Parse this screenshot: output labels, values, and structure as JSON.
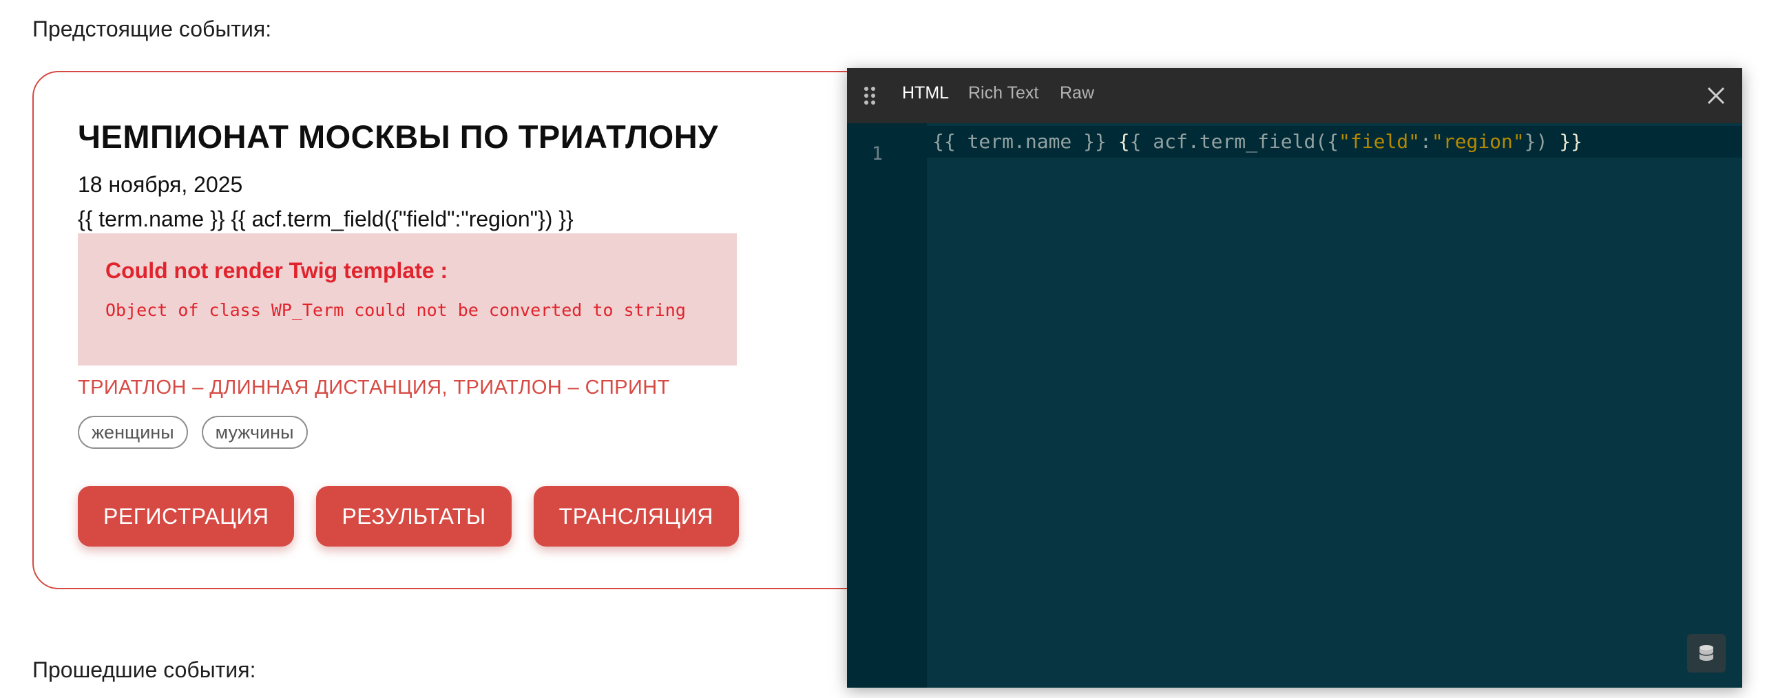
{
  "sections": {
    "upcoming_label": "Предстоящие события:",
    "past_label": "Прошедшие события:"
  },
  "event": {
    "title": "ЧЕМПИОНАТ МОСКВЫ ПО ТРИАТЛОНУ",
    "date": "18 ноября, 2025",
    "template_text": "{{ term.name }} {{ acf.term_field({\"field\":\"region\"}) }}",
    "error": {
      "title": "Could not render Twig template :",
      "message": "Object of class WP_Term could not be converted to string"
    },
    "disciplines": "ТРИАТЛОН – ДЛИННАЯ ДИСТАНЦИЯ, ТРИАТЛОН – СПРИНТ",
    "tags": [
      "женщины",
      "мужчины"
    ],
    "buttons": {
      "register": "РЕГИСТРАЦИЯ",
      "results": "РЕЗУЛЬТАТЫ",
      "broadcast": "ТРАНСЛЯЦИЯ"
    },
    "colors": {
      "accent": "#d64a43",
      "error_text": "#e0232c",
      "error_bg": "#f0d2d3"
    }
  },
  "editor": {
    "tabs": [
      "HTML",
      "Rich Text",
      "Raw"
    ],
    "active_tab": "HTML",
    "line_number": "1",
    "code_tokens": {
      "t1": "{{ term.name }} ",
      "t2": "{",
      "t3": "{ acf.term_field({",
      "t4": "\"field\"",
      "t5": ":",
      "t6": "\"region\"",
      "t7": "}) ",
      "t8": "}}"
    },
    "icons": {
      "drag": "drag-handle-icon",
      "close": "close-icon",
      "database": "database-icon"
    },
    "colors": {
      "background": "#073642",
      "toolbar": "#2b2b2b",
      "string": "#b58900"
    }
  }
}
